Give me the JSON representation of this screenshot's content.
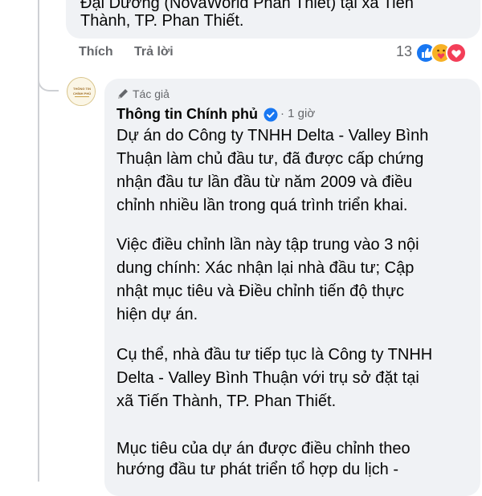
{
  "previous_comment": {
    "lines": [
      "Đại Dương (NovaWorld Phan Thiết) tại xã Tiến",
      "Thành, TP. Phan Thiết."
    ],
    "like_label": "Thích",
    "reply_label": "Trả lời",
    "reaction_count": "13",
    "reaction_icons": [
      "like-icon",
      "care-icon",
      "love-icon"
    ]
  },
  "reply": {
    "author_badge": "Tác giả",
    "author_name": "Thông tin Chính phủ",
    "verified_icon": "verified-badge-icon",
    "separator": "·",
    "time": "1 giờ",
    "avatar_text": "THÔNG TIN CHÍNH PHỦ",
    "lines": [
      "Dự án do Công ty TNHH Delta - Valley Bình",
      "Thuận làm chủ đầu tư, đã được cấp chứng",
      "nhận đầu tư lần đầu từ năm 2009 và điều",
      "chỉnh nhiều lần trong quá trình triển khai.",
      "Việc điều chỉnh lần này tập trung vào 3 nội",
      "dung chính: Xác nhận lại nhà đầu tư; Cập",
      "nhật mục tiêu và Điều chỉnh tiến độ thực",
      "hiện dự án.",
      "Cụ thể, nhà đầu tư tiếp tục là Công ty TNHH",
      "Delta - Valley Bình Thuận với trụ sở đặt tại",
      "xã Tiến Thành, TP. Phan Thiết.",
      "Mục tiêu của dự án được điều chỉnh theo",
      "hướng đầu tư phát triển tổ hợp du lịch -"
    ]
  },
  "colors": {
    "bubble": "#f0f2f5",
    "secondary_text": "#65676b",
    "primary_text": "#050505",
    "verified": "#1877f2",
    "love": "#f33e58",
    "care": "#f7b125"
  }
}
